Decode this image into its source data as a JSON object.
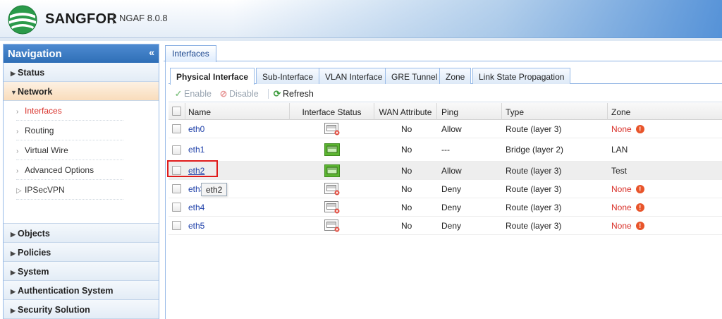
{
  "header": {
    "brand": "SANGFOR",
    "version": "NGAF 8.0.8"
  },
  "navigation": {
    "title": "Navigation",
    "collapse_glyph": "«",
    "sections_top": [
      {
        "label": "Status",
        "expanded": false
      },
      {
        "label": "Network",
        "expanded": true
      }
    ],
    "network_items": [
      "Interfaces",
      "Routing",
      "Virtual Wire",
      "Advanced Options",
      "IPSecVPN"
    ],
    "sections_bottom": [
      "Objects",
      "Policies",
      "System",
      "Authentication System",
      "Security Solution"
    ]
  },
  "main_tab": "Interfaces",
  "sub_tabs": [
    "Physical Interface",
    "Sub-Interface",
    "VLAN Interface",
    "GRE Tunnel",
    "Zone",
    "Link State Propagation"
  ],
  "toolbar": {
    "enable": "Enable",
    "disable": "Disable",
    "refresh": "Refresh"
  },
  "table": {
    "columns": [
      "Name",
      "Interface Status",
      "WAN Attribute",
      "Ping",
      "Type",
      "Zone"
    ],
    "rows": [
      {
        "name": "eth0",
        "status": "down",
        "wan": "No",
        "ping": "Allow",
        "type": "Route (layer 3)",
        "zone": "None",
        "zone_warn": true
      },
      {
        "name": "eth1",
        "status": "up",
        "wan": "No",
        "ping": "---",
        "type": "Bridge (layer 2)",
        "zone": "LAN",
        "zone_warn": false
      },
      {
        "name": "eth2",
        "status": "up",
        "wan": "No",
        "ping": "Allow",
        "type": "Route (layer 3)",
        "zone": "Test",
        "zone_warn": false
      },
      {
        "name": "eth3",
        "status": "down",
        "wan": "No",
        "ping": "Deny",
        "type": "Route (layer 3)",
        "zone": "None",
        "zone_warn": true
      },
      {
        "name": "eth4",
        "status": "down",
        "wan": "No",
        "ping": "Deny",
        "type": "Route (layer 3)",
        "zone": "None",
        "zone_warn": true
      },
      {
        "name": "eth5",
        "status": "down",
        "wan": "No",
        "ping": "Deny",
        "type": "Route (layer 3)",
        "zone": "None",
        "zone_warn": true
      }
    ]
  },
  "tooltip": "eth2",
  "colors": {
    "port_up": "#5cb531",
    "zone_none": "#d9312a",
    "highlight": "#e01b1b"
  }
}
